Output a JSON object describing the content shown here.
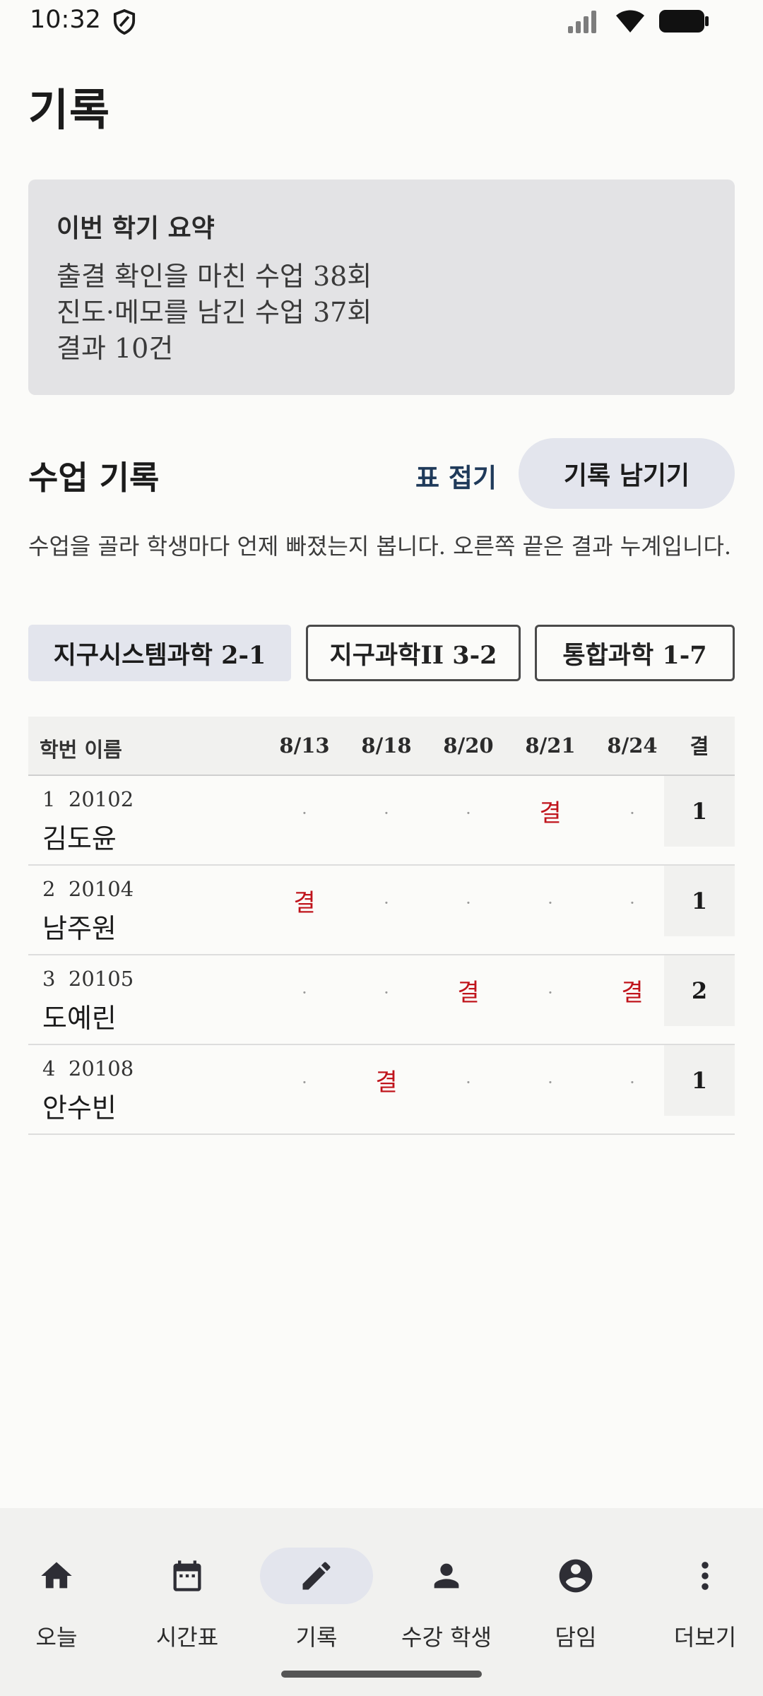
{
  "status": {
    "time": "10:32"
  },
  "page": {
    "title": "기록"
  },
  "summary": {
    "heading": "이번 학기 요약",
    "lines": [
      "출결 확인을 마친 수업 38회",
      "진도·메모를 남긴 수업 37회",
      "결과 10건"
    ]
  },
  "section": {
    "title": "수업 기록",
    "collapse_label": "표 접기",
    "record_button_label": "기록 남기기",
    "description": "수업을 골라 학생마다 언제 빠졌는지 봅니다. 오른쪽 끝은 결과 누계입니다."
  },
  "classes": [
    {
      "label": "지구시스템과학 2-1",
      "active": true
    },
    {
      "label": "지구과학II 3-2",
      "active": false
    },
    {
      "label": "통합과학 1-7",
      "active": false
    }
  ],
  "table": {
    "header_label": "학번 이름",
    "dates": [
      "8/13",
      "8/18",
      "8/20",
      "8/21",
      "8/24"
    ],
    "total_label": "결",
    "absent_mark": "결",
    "present_mark": "·",
    "rows": [
      {
        "no": "1",
        "id": "20102",
        "name": "김도윤",
        "marks": [
          "·",
          "·",
          "·",
          "결",
          "·"
        ],
        "total": "1"
      },
      {
        "no": "2",
        "id": "20104",
        "name": "남주원",
        "marks": [
          "결",
          "·",
          "·",
          "·",
          "·"
        ],
        "total": "1"
      },
      {
        "no": "3",
        "id": "20105",
        "name": "도예린",
        "marks": [
          "·",
          "·",
          "결",
          "·",
          "결"
        ],
        "total": "2"
      },
      {
        "no": "4",
        "id": "20108",
        "name": "안수빈",
        "marks": [
          "·",
          "결",
          "·",
          "·",
          "·"
        ],
        "total": "1"
      }
    ]
  },
  "nav": {
    "items": [
      {
        "label": "오늘",
        "icon": "home-icon",
        "active": false
      },
      {
        "label": "시간표",
        "icon": "calendar-icon",
        "active": false
      },
      {
        "label": "기록",
        "icon": "pencil-icon",
        "active": true
      },
      {
        "label": "수강 학생",
        "icon": "person-icon",
        "active": false
      },
      {
        "label": "담임",
        "icon": "account-circle-icon",
        "active": false
      },
      {
        "label": "더보기",
        "icon": "more-vertical-icon",
        "active": false
      }
    ]
  }
}
